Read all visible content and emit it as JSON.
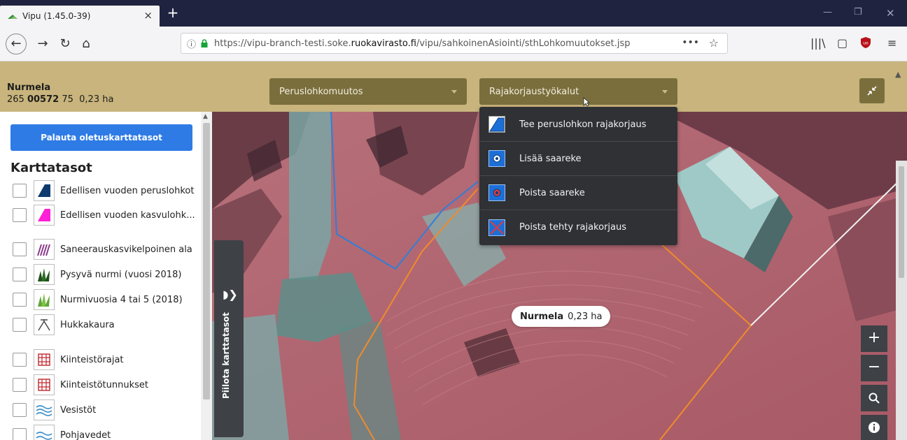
{
  "browser": {
    "tab_title": "Vipu (1.45.0-39)",
    "tab_close": "×",
    "new_tab": "+",
    "url_prefix": "https://vipu-branch-testi.soke.",
    "url_domain": "ruokavirasto.fi",
    "url_path": "/vipu/sahkoinenAsiointi/sthLohkomuutokset.jsp",
    "more_label": "•••",
    "star_icon": "star-icon"
  },
  "header": {
    "parcel_name": "Nurmela",
    "parcel_id_prefix": "265",
    "parcel_id_bold": "00572",
    "parcel_id_suffix": "75",
    "parcel_area": "0,23 ha",
    "dropdown1": "Peruslohkomuutos",
    "dropdown2": "Rajakorjaustyökalut"
  },
  "menu": {
    "items": [
      {
        "label": "Tee peruslohkon rajakorjaus",
        "icon": "polygon-edit-icon"
      },
      {
        "label": "Lisää saareke",
        "icon": "add-island-icon"
      },
      {
        "label": "Poista saareke",
        "icon": "remove-island-icon"
      },
      {
        "label": "Poista tehty rajakorjaus",
        "icon": "remove-correction-icon"
      }
    ]
  },
  "sidebar": {
    "reset_button": "Palauta oletuskarttatasot",
    "title": "Karttatasot",
    "layers": [
      {
        "label": "Edellisen vuoden peruslohkot",
        "icon": "parcel-swatch-icon"
      },
      {
        "label": "Edellisen vuoden kasvulohk...",
        "icon": "crop-parcel-swatch-icon"
      },
      {
        "label": "Saneerauskasvikelpoinen ala",
        "icon": "hatched-swatch-icon"
      },
      {
        "label": "Pysyvä nurmi (vuosi 2018)",
        "icon": "grass-dark-icon"
      },
      {
        "label": "Nurmivuosia 4 tai 5 (2018)",
        "icon": "grass-light-icon"
      },
      {
        "label": "Hukkakaura",
        "icon": "wild-oat-icon"
      },
      {
        "label": "Kiinteistörajat",
        "icon": "property-grid-icon"
      },
      {
        "label": "Kiinteistötunnukset",
        "icon": "property-id-icon"
      },
      {
        "label": "Vesistöt",
        "icon": "water-icon"
      },
      {
        "label": "Pohjavedet",
        "icon": "groundwater-icon"
      }
    ]
  },
  "map": {
    "hide_layers_label": "Piilota karttatasot",
    "bubble_name": "Nurmela",
    "bubble_area": "0,23 ha",
    "zoom_in": "+",
    "zoom_out": "−"
  }
}
